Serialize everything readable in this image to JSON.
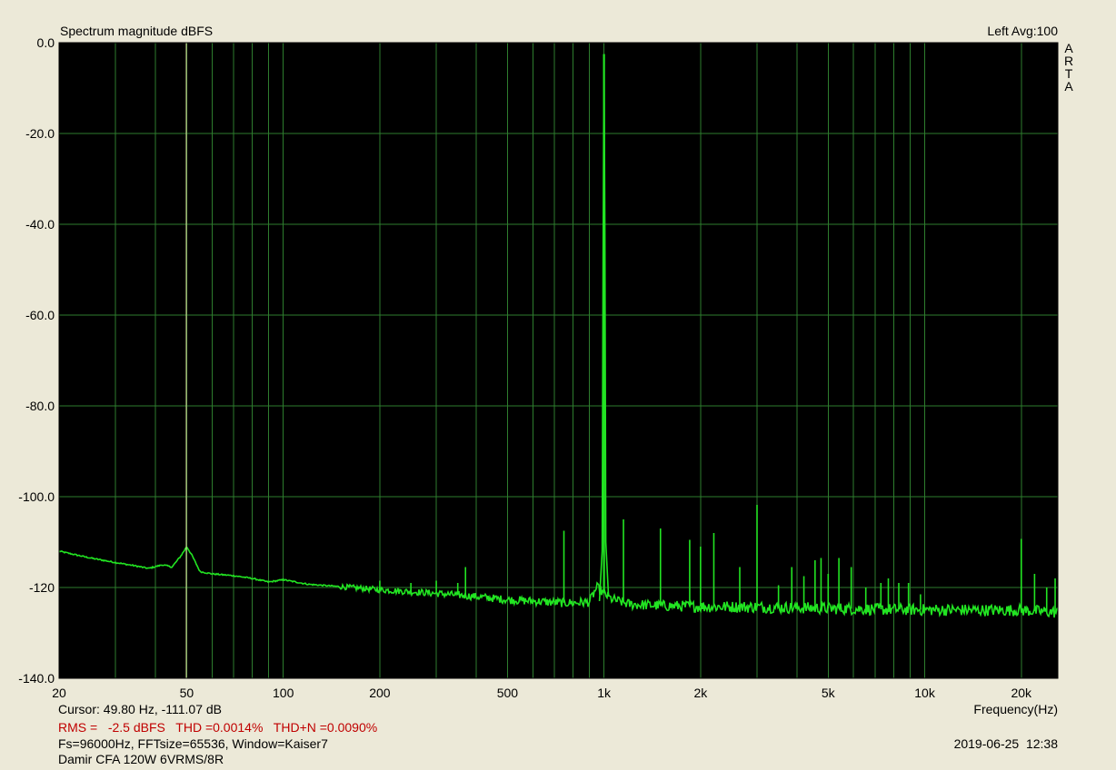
{
  "header": {
    "title": "Spectrum magnitude dBFS",
    "channel_info": "Left  Avg:100",
    "brand_letters": [
      "A",
      "R",
      "T",
      "A"
    ]
  },
  "footer": {
    "cursor": "Cursor: 49.80 Hz, -111.07 dB",
    "measurements": "RMS =   -2.5 dBFS   THD =0.0014%   THD+N =0.0090%",
    "settings": "Fs=96000Hz, FFTsize=65536, Window=Kaiser7",
    "device": "Damir CFA 120W 6VRMS/8R",
    "timestamp": "2019-06-25  12:38"
  },
  "colors": {
    "background": "#ece9d8",
    "plot_background": "#000000",
    "grid": "#2e7d2e",
    "trace": "#22e422",
    "cursor_line": "#e8f0a8",
    "measurement_text": "#c00000"
  },
  "chart_data": {
    "type": "line",
    "xscale": "log",
    "xlabel": "Frequency(Hz)",
    "ylabel": "",
    "xlim": [
      20,
      26000
    ],
    "ylim": [
      -140,
      0
    ],
    "grid": true,
    "y_ticks": [
      0,
      -20,
      -40,
      -60,
      -80,
      -100,
      -120,
      -140
    ],
    "y_tick_labels": [
      "0.0",
      "-20.0",
      "-40.0",
      "-60.0",
      "-80.0",
      "-100.0",
      "-120",
      "-140.0"
    ],
    "x_ticks": [
      20,
      50,
      100,
      200,
      500,
      1000,
      2000,
      5000,
      10000,
      20000
    ],
    "x_tick_labels": [
      "20",
      "50",
      "100",
      "200",
      "500",
      "1k",
      "2k",
      "5k",
      "10k",
      "20k"
    ],
    "cursor_x": 49.8,
    "noise_floor": {
      "x": [
        20,
        25,
        30,
        35,
        38,
        42,
        45,
        48,
        50,
        52,
        55,
        60,
        70,
        80,
        90,
        100,
        120,
        150,
        200,
        300,
        400,
        500,
        600,
        700,
        800,
        900,
        950,
        1050,
        1200,
        1500,
        2000,
        3000,
        5000,
        7000,
        10000,
        15000,
        20000,
        26000
      ],
      "y": [
        -112,
        -113.5,
        -114.5,
        -115.3,
        -115.8,
        -115,
        -115.5,
        -113,
        -111,
        -113,
        -116.5,
        -117,
        -117.4,
        -118,
        -118.8,
        -118.3,
        -119.3,
        -119.8,
        -120.5,
        -121.3,
        -122,
        -122.7,
        -123,
        -123.3,
        -123.4,
        -123.2,
        -120,
        -122.5,
        -123.7,
        -124,
        -124.2,
        -124.3,
        -124.6,
        -124.8,
        -124.9,
        -125,
        -125,
        -125.5
      ]
    },
    "spikes": {
      "x": [
        100,
        200,
        250,
        300,
        350,
        370,
        750,
        1000,
        1150,
        1500,
        1850,
        2000,
        2200,
        2650,
        3000,
        3500,
        3850,
        4200,
        4550,
        4750,
        5000,
        5400,
        5900,
        6550,
        7300,
        7700,
        8300,
        8900,
        9700,
        20000,
        22000,
        24000,
        25500
      ],
      "y": [
        -118,
        -118.5,
        -119,
        -118.5,
        -119,
        -115.5,
        -107.5,
        -2.5,
        -105,
        -107,
        -109.5,
        -111,
        -108,
        -115.5,
        -101.8,
        -119.5,
        -115.5,
        -117.5,
        -114,
        -113.5,
        -117,
        -113.5,
        -115.5,
        -120,
        -119,
        -118,
        -119,
        -119,
        -121.5,
        -109.3,
        -117,
        -120,
        -118
      ]
    }
  }
}
